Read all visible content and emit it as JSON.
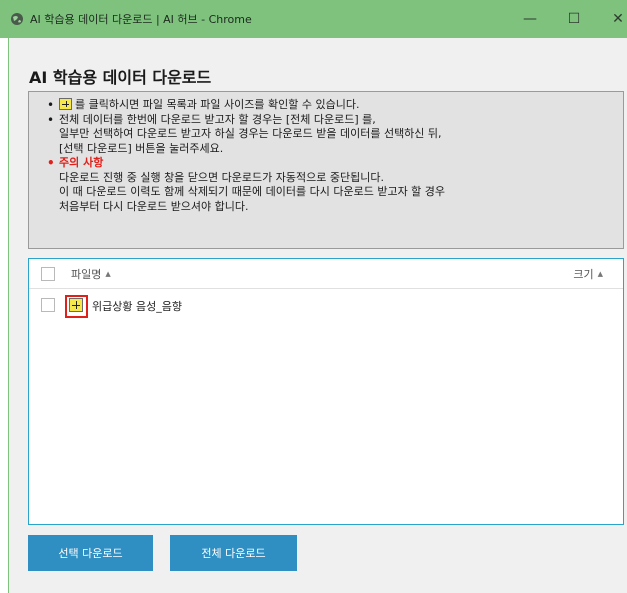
{
  "window": {
    "title": "AI 학습용 데이터 다운로드 | AI 허브 - Chrome",
    "minimize": "—",
    "maximize": "☐",
    "close": "✕",
    "titlebar_color": "#7ec27e"
  },
  "page": {
    "heading": "AI 학습용 데이터 다운로드",
    "notice": {
      "line1": "를 클릭하시면 파일 목록과 파일 사이즈를 확인할 수 있습니다.",
      "line2": "전체 데이터를 한번에 다운로드 받고자 할 경우는 [전체 다운로드] 를,",
      "line3": "일부만 선택하여 다운로드 받고자 하실 경우는 다운로드 받을 데이터를 선택하신 뒤,",
      "line4": "[선택 다운로드] 버튼을 눌러주세요.",
      "warning_title": "주의 사항",
      "line5": "다운로드 진행 중 실행 창을 닫으면 다운로드가 자동적으로 중단됩니다.",
      "line6": "이 때 다운로드 이력도 함께 삭제되기 때문에 데이터를 다시 다운로드 받고자 할 경우",
      "line7": "처음부터 다시 다운로드 받으셔야 합니다.",
      "warning_color": "#e0201a"
    },
    "file_list": {
      "columns": {
        "name": "파일명",
        "size": "크기"
      },
      "sort_indicator": "▲",
      "rows": [
        {
          "name": "위급상황 음성_음향",
          "size": ""
        }
      ]
    },
    "buttons": {
      "selected_download": "선택 다운로드",
      "all_download": "전체 다운로드",
      "color": "#2f8ec2"
    }
  }
}
